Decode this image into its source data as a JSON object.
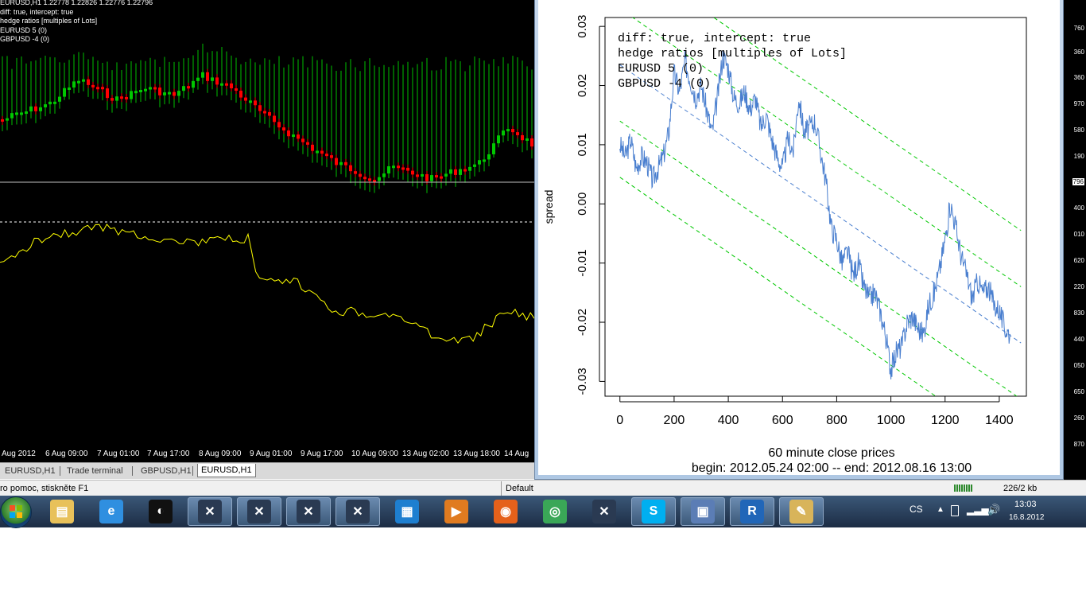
{
  "chart_window": {
    "legend": [
      "EURUSD,H1  1.22778 1.22826 1.22776 1.22796",
      "diff: true, intercept: true",
      "hedge ratios [multiples of Lots]",
      "EURUSD 5 (0)",
      "GBPUSD -4 (0)"
    ],
    "time_labels": [
      "Aug 2012",
      "6 Aug 09:00",
      "7 Aug 01:00",
      "7 Aug 17:00",
      "8 Aug 09:00",
      "9 Aug 01:00",
      "9 Aug 17:00",
      "10 Aug 09:00",
      "13 Aug 02:00",
      "13 Aug 18:00",
      "14 Aug"
    ],
    "colors": {
      "bg": "#000000",
      "bull_candle": "#00c800",
      "bear_candle": "#ff0000",
      "histogram": "#00c000",
      "indicator": "#ffff00",
      "hline": "#c0c0c0"
    }
  },
  "tabs": [
    {
      "label": "EURUSD,H1",
      "active": false
    },
    {
      "label": "Trade terminal",
      "active": false
    },
    {
      "label": "GBPUSD,H1",
      "active": false
    },
    {
      "label": "EURUSD,H1",
      "active": true
    }
  ],
  "price_scale": [
    "760",
    "360",
    "970",
    "580",
    "190",
    "796",
    "400",
    "010",
    "620",
    "220",
    "830",
    "440",
    "050",
    "650",
    "260",
    "870"
  ],
  "status_bar": {
    "help": "ro pomoc, stiskněte F1",
    "profile": "Default",
    "traffic": "226/2 kb"
  },
  "r_plot": {
    "annotation": [
      "diff: true, intercept: true",
      "hedge ratios [multiples of Lots]",
      "EURUSD 5 (0)",
      "GBPUSD -4 (0)"
    ],
    "xlabel": "60 minute close prices",
    "subtitle": "begin: 2012.05.24 02:00 -- end: 2012.08.16 13:00",
    "ylabel": "spread",
    "colors": {
      "series": "#4a7fcf",
      "regression": "#4a7fcf",
      "bands": "#00c800"
    }
  },
  "chart_data": {
    "type": "line",
    "xlabel": "60 minute close prices",
    "ylabel": "spread",
    "xlim": [
      0,
      1440
    ],
    "ylim": [
      -0.032,
      0.032
    ],
    "x_ticks": [
      0,
      200,
      400,
      600,
      800,
      1000,
      1200,
      1400
    ],
    "y_ticks": [
      "-0.03",
      "-0.02",
      "-0.01",
      "0.00",
      "0.01",
      "0.02",
      "0.03"
    ],
    "series": [
      {
        "x": [
          0,
          20,
          40,
          60,
          80,
          100,
          120,
          140,
          160,
          180,
          200,
          220,
          240,
          260,
          280,
          300,
          320,
          340,
          360,
          380,
          400,
          420,
          440,
          460,
          480,
          500,
          520,
          540,
          560,
          580,
          600,
          620,
          640,
          660,
          680,
          700,
          720,
          740,
          760,
          780,
          800,
          820,
          840,
          860,
          880,
          900,
          920,
          940,
          960,
          980,
          1000,
          1020,
          1040,
          1060,
          1080,
          1100,
          1120,
          1140,
          1160,
          1180,
          1200,
          1220,
          1240,
          1260,
          1280,
          1300,
          1320,
          1340,
          1360,
          1380,
          1400,
          1420,
          1440
        ],
        "values": [
          0.01,
          0.008,
          0.011,
          0.006,
          0.008,
          0.007,
          0.004,
          0.006,
          0.008,
          0.012,
          0.022,
          0.019,
          0.024,
          0.021,
          0.018,
          0.02,
          0.016,
          0.012,
          0.018,
          0.025,
          0.023,
          0.018,
          0.017,
          0.019,
          0.016,
          0.018,
          0.013,
          0.015,
          0.011,
          0.008,
          0.006,
          0.011,
          0.009,
          0.018,
          0.012,
          0.013,
          0.014,
          0.009,
          0.004,
          -0.004,
          -0.006,
          -0.01,
          -0.008,
          -0.012,
          -0.01,
          -0.014,
          -0.016,
          -0.015,
          -0.018,
          -0.022,
          -0.028,
          -0.025,
          -0.024,
          -0.02,
          -0.019,
          -0.021,
          -0.022,
          -0.017,
          -0.015,
          -0.011,
          -0.006,
          0.0,
          -0.004,
          -0.009,
          -0.012,
          -0.016,
          -0.013,
          -0.015,
          -0.014,
          -0.017,
          -0.018,
          -0.021,
          -0.022
        ]
      }
    ],
    "regression": {
      "y_at_0": 0.0235,
      "y_at_1480": -0.0235
    },
    "band_offsets": [
      -0.019,
      -0.0095,
      0.0095,
      0.019
    ]
  },
  "taskbar": {
    "buttons": [
      {
        "name": "explorer-icon",
        "active": false
      },
      {
        "name": "internet-explorer-icon",
        "active": false
      },
      {
        "name": "live-app-icon",
        "active": false
      },
      {
        "name": "metatrader-icon-1",
        "active": true
      },
      {
        "name": "metatrader-icon-2",
        "active": true
      },
      {
        "name": "metatrader-icon-3",
        "active": true
      },
      {
        "name": "metatrader-icon-4",
        "active": true
      },
      {
        "name": "csm-icon",
        "active": false
      },
      {
        "name": "media-player-icon",
        "active": false
      },
      {
        "name": "firefox-icon",
        "active": false
      },
      {
        "name": "chrome-icon",
        "active": false
      },
      {
        "name": "metatrader-icon-5",
        "active": false
      },
      {
        "name": "skype-icon",
        "active": true
      },
      {
        "name": "remote-desktop-icon",
        "active": true
      },
      {
        "name": "r-icon",
        "active": true
      },
      {
        "name": "paint-icon",
        "active": true
      }
    ],
    "language": "CS",
    "clock_time": "13:03",
    "clock_date": "16.8.2012"
  }
}
